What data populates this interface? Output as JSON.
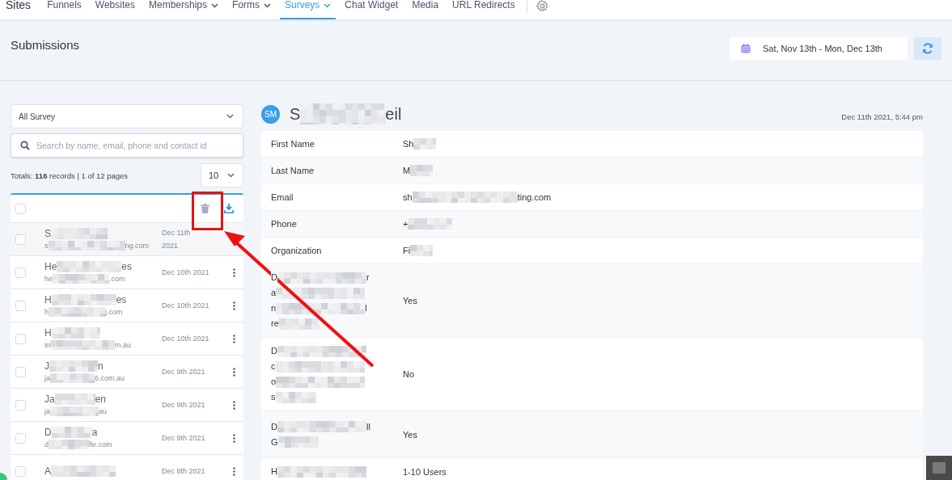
{
  "nav": {
    "brand": "Sites",
    "items": [
      {
        "label": "Funnels",
        "dropdown": false,
        "selected": false
      },
      {
        "label": "Websites",
        "dropdown": false,
        "selected": false
      },
      {
        "label": "Memberships",
        "dropdown": true,
        "selected": false
      },
      {
        "label": "Forms",
        "dropdown": true,
        "selected": false
      },
      {
        "label": "Surveys",
        "dropdown": true,
        "selected": true
      },
      {
        "label": "Chat Widget",
        "dropdown": false,
        "selected": false
      },
      {
        "label": "Media",
        "dropdown": false,
        "selected": false
      },
      {
        "label": "URL Redirects",
        "dropdown": false,
        "selected": false
      }
    ]
  },
  "header": {
    "title": "Submissions",
    "date_range": "Sat, Nov 13th - Mon, Dec 13th"
  },
  "filters": {
    "survey_select": "All Survey",
    "search": {
      "placeholder": "Search by name, email, phone and contact id"
    },
    "totals": "Totals: **116** records | 1 of 12 pages",
    "page_size": "10"
  },
  "list_header": {
    "select_all_checked": false
  },
  "submissions": [
    {
      "name": {
        "start": "S"
      },
      "email": {
        "start": "s",
        "end": "ng.com"
      },
      "date": "Dec 11th 2021",
      "checked": false,
      "selected": true
    },
    {
      "name": {
        "start": "He",
        "end": "es"
      },
      "email": {
        "start": "he",
        "end": ".com"
      },
      "date": "Dec 10th 2021",
      "checked": false,
      "selected": false
    },
    {
      "name": {
        "start": "H",
        "end": "es"
      },
      "email": {
        "start": "h",
        "end": "j.com"
      },
      "date": "Dec 10th 2021",
      "checked": false,
      "selected": false
    },
    {
      "name": {
        "start": "H"
      },
      "email": {
        "start": "in",
        "end": "m.au"
      },
      "date": "Dec 10th 2021",
      "checked": false,
      "selected": false
    },
    {
      "name": {
        "start": "J",
        "end": "n"
      },
      "email": {
        "start": "ja",
        "end": "6.com.au"
      },
      "date": "Dec 9th 2021",
      "checked": false,
      "selected": false
    },
    {
      "name": {
        "start": "Ja",
        "end": "en"
      },
      "email": {
        "start": "ja",
        "end": "au"
      },
      "date": "Dec 9th 2021",
      "checked": false,
      "selected": false
    },
    {
      "name": {
        "start": "D",
        "end": "a"
      },
      "email": {
        "start": "d",
        "end": "lle.com"
      },
      "date": "Dec 9th 2021",
      "checked": false,
      "selected": false
    },
    {
      "name": {
        "start": "A"
      },
      "date": "Dec 8th 2021",
      "checked": false,
      "selected": false
    }
  ],
  "detail": {
    "initials": "SM",
    "name": {
      "start": "S",
      "end": "eil"
    },
    "timestamp": "Dec 11th 2021, 5:44 pm",
    "fields": [
      {
        "label": "First Name",
        "value": {
          "start": "Sh"
        }
      },
      {
        "label": "Last Name",
        "value": {
          "start": "M"
        }
      },
      {
        "label": "Email",
        "value": {
          "start": "sh",
          "end": "ting.com"
        }
      },
      {
        "label": "Phone",
        "value": {
          "start": "+"
        }
      },
      {
        "label": "Organization",
        "value": {
          "start": "Fi"
        }
      },
      {
        "label": [
          {
            "start": "D",
            "end": "r"
          },
          {
            "start": "a"
          },
          {
            "start": "n",
            "end": "l"
          },
          {
            "start": "re"
          }
        ],
        "value": "Yes"
      },
      {
        "label": [
          {
            "start": "D"
          },
          {
            "start": "c"
          },
          {
            "start": "o"
          },
          {
            "start": "s"
          }
        ],
        "value": "No"
      },
      {
        "label": [
          {
            "start": "D",
            "end": "ll"
          },
          {
            "start": "G"
          }
        ],
        "value": "Yes"
      },
      {
        "label": [
          {
            "start": "H"
          }
        ],
        "value": "1-10 Users"
      }
    ]
  }
}
